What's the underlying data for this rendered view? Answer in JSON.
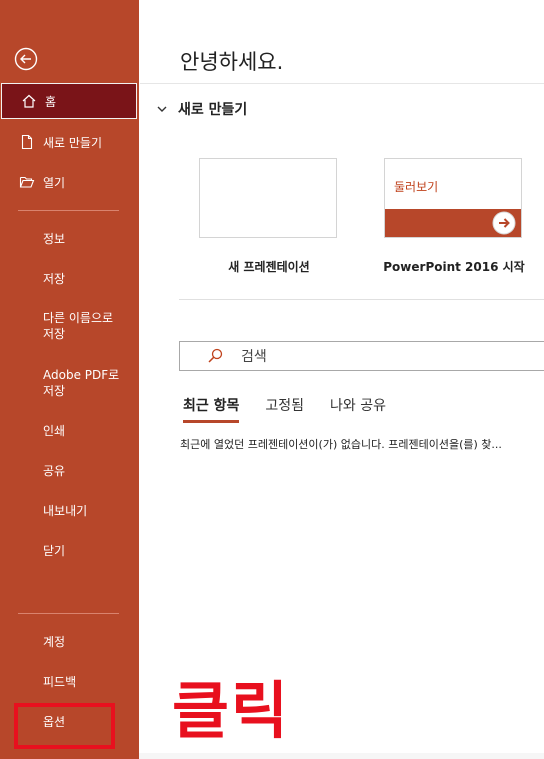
{
  "colors": {
    "accent": "#b7472a",
    "active": "#7a1418",
    "annotation": "#e8101e"
  },
  "sidebar": {
    "back_icon": "back-arrow-circle-icon",
    "home": {
      "label": "홈",
      "icon": "home-icon"
    },
    "new": {
      "label": "새로 만들기",
      "icon": "new-document-icon"
    },
    "open": {
      "label": "열기",
      "icon": "folder-open-icon"
    },
    "items": [
      {
        "label": "정보"
      },
      {
        "label": "저장"
      },
      {
        "label": "다른 이름으로 저장"
      },
      {
        "label": "Adobe PDF로 저장"
      },
      {
        "label": "인쇄"
      },
      {
        "label": "공유"
      },
      {
        "label": "내보내기"
      },
      {
        "label": "닫기"
      }
    ],
    "bottom": [
      {
        "label": "계정"
      },
      {
        "label": "피드백"
      },
      {
        "label": "옵션"
      }
    ]
  },
  "main": {
    "greeting": "안녕하세요.",
    "section_title": "새로 만들기",
    "templates": [
      {
        "label": "새 프레젠테이션"
      },
      {
        "label": "PowerPoint 2016 시작",
        "thumb_text": "둘러보기"
      }
    ],
    "search": {
      "placeholder": "검색"
    },
    "tabs": [
      {
        "label": "최근 항목",
        "active": true
      },
      {
        "label": "고정됨"
      },
      {
        "label": "나와 공유"
      }
    ],
    "empty_message": "최근에 열었던 프레젠테이션이(가) 없습니다. 프레젠테이션을(를) 찾..."
  },
  "annotation": {
    "text": "클릭"
  }
}
